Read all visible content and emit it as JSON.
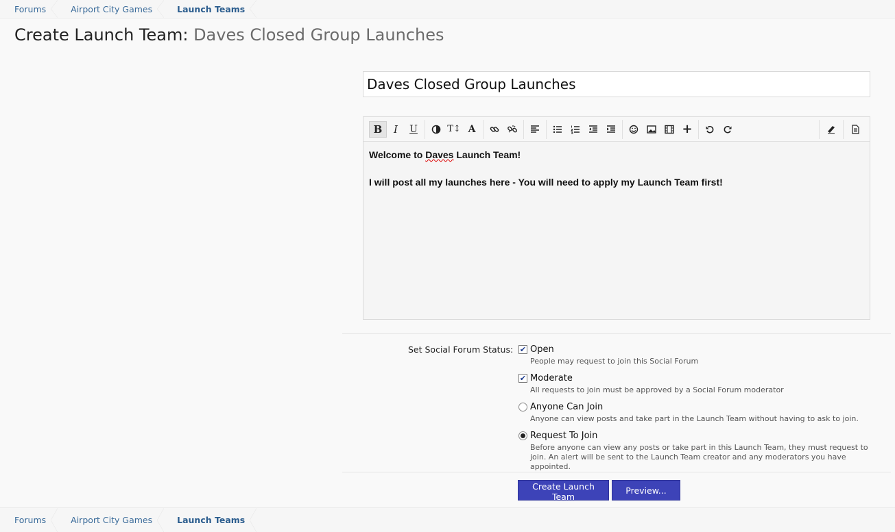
{
  "breadcrumb": [
    "Forums",
    "Airport City Games",
    "Launch Teams"
  ],
  "title": {
    "prefix": "Create Launch Team: ",
    "name": "Daves Closed Group Launches"
  },
  "title_input_value": "Daves Closed Group Launches",
  "toolbar": {
    "groups": [
      [
        "bold-icon",
        "italic-icon",
        "underline-icon"
      ],
      [
        "text-color-icon",
        "font-size-icon",
        "font-icon"
      ],
      [
        "link-icon",
        "unlink-icon"
      ],
      [
        "align-left-icon"
      ],
      [
        "bulleted-list-icon",
        "numbered-list-icon",
        "outdent-icon",
        "indent-icon"
      ],
      [
        "smilie-icon",
        "image-icon",
        "media-icon",
        "insert-more-icon"
      ],
      [
        "undo-icon",
        "redo-icon"
      ]
    ],
    "right": [
      "remove-formatting-icon",
      "source-mode-icon"
    ]
  },
  "editor": {
    "line1_pre": "Welcome to ",
    "line1_mis": "Daves",
    "line1_post": " Launch Team!",
    "line2": "I will post all my launches here - You will need to apply my Launch Team first!"
  },
  "status": {
    "label": "Set Social Forum Status:",
    "options": [
      {
        "type": "checkbox",
        "checked": true,
        "label": "Open",
        "desc": "People may request to join this Social Forum"
      },
      {
        "type": "checkbox",
        "checked": true,
        "label": "Moderate",
        "desc": "All requests to join must be approved by a Social Forum moderator"
      },
      {
        "type": "radio",
        "checked": false,
        "label": "Anyone Can Join",
        "desc": "Anyone can view posts and take part in the Launch Team without having to ask to join."
      },
      {
        "type": "radio",
        "checked": true,
        "label": "Request To Join",
        "desc": "Before anyone can view any posts or take part in this Launch Team, they must request to join. An alert will be sent to the Launch Team creator and any moderators you have appointed."
      }
    ]
  },
  "buttons": {
    "create": "Create Launch Team",
    "preview": "Preview..."
  }
}
